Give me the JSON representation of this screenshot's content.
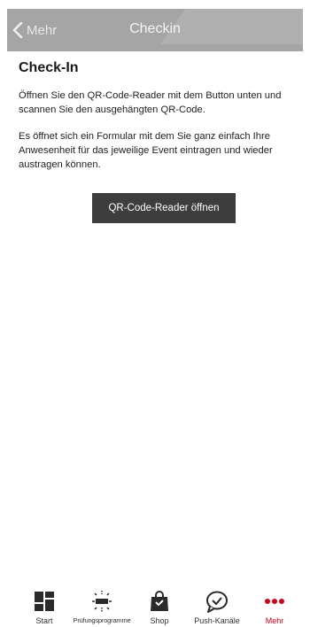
{
  "nav": {
    "back_label": "Mehr",
    "title": "Checkin"
  },
  "content": {
    "heading": "Check-In",
    "paragraph1": "Öffnen Sie den QR-Code-Reader mit dem Button unten und scannen Sie den ausgehängten QR-Code.",
    "paragraph2": "Es öffnet sich ein Formular mit dem Sie ganz einfach Ihre Anwesenheit für das jeweilige Event eintragen und wieder austragen können.",
    "button_label": "QR-Code-Reader öffnen"
  },
  "tabbar": {
    "items": [
      {
        "label": "Start",
        "icon": "grid-icon"
      },
      {
        "label": "Prüfungsprogramme",
        "icon": "scan-icon"
      },
      {
        "label": "Shop",
        "icon": "shopping-bag-icon"
      },
      {
        "label": "Push-Kanäle",
        "icon": "chat-check-icon"
      },
      {
        "label": "Mehr",
        "icon": "more-dots-icon",
        "active": true
      }
    ],
    "active_color": "#d0021b"
  },
  "colors": {
    "navbar": "#a5a5a5",
    "button": "#3d3d3d",
    "accent": "#d0021b"
  }
}
